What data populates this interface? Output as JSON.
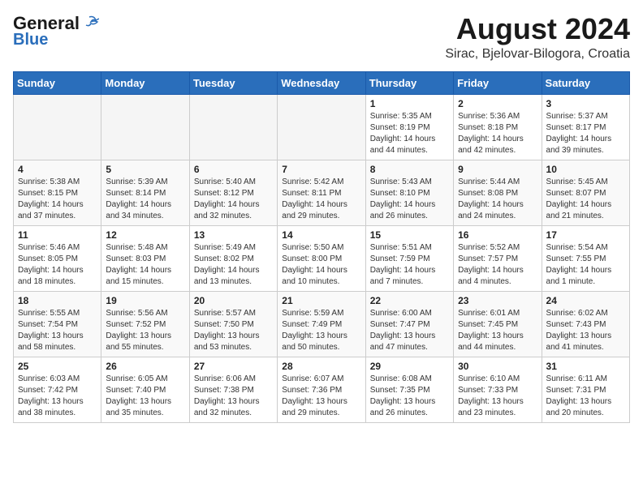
{
  "header": {
    "logo_line1": "General",
    "logo_line2": "Blue",
    "title": "August 2024",
    "subtitle": "Sirac, Bjelovar-Bilogora, Croatia"
  },
  "days_of_week": [
    "Sunday",
    "Monday",
    "Tuesday",
    "Wednesday",
    "Thursday",
    "Friday",
    "Saturday"
  ],
  "weeks": [
    [
      {
        "day": "",
        "info": ""
      },
      {
        "day": "",
        "info": ""
      },
      {
        "day": "",
        "info": ""
      },
      {
        "day": "",
        "info": ""
      },
      {
        "day": "1",
        "info": "Sunrise: 5:35 AM\nSunset: 8:19 PM\nDaylight: 14 hours\nand 44 minutes."
      },
      {
        "day": "2",
        "info": "Sunrise: 5:36 AM\nSunset: 8:18 PM\nDaylight: 14 hours\nand 42 minutes."
      },
      {
        "day": "3",
        "info": "Sunrise: 5:37 AM\nSunset: 8:17 PM\nDaylight: 14 hours\nand 39 minutes."
      }
    ],
    [
      {
        "day": "4",
        "info": "Sunrise: 5:38 AM\nSunset: 8:15 PM\nDaylight: 14 hours\nand 37 minutes."
      },
      {
        "day": "5",
        "info": "Sunrise: 5:39 AM\nSunset: 8:14 PM\nDaylight: 14 hours\nand 34 minutes."
      },
      {
        "day": "6",
        "info": "Sunrise: 5:40 AM\nSunset: 8:12 PM\nDaylight: 14 hours\nand 32 minutes."
      },
      {
        "day": "7",
        "info": "Sunrise: 5:42 AM\nSunset: 8:11 PM\nDaylight: 14 hours\nand 29 minutes."
      },
      {
        "day": "8",
        "info": "Sunrise: 5:43 AM\nSunset: 8:10 PM\nDaylight: 14 hours\nand 26 minutes."
      },
      {
        "day": "9",
        "info": "Sunrise: 5:44 AM\nSunset: 8:08 PM\nDaylight: 14 hours\nand 24 minutes."
      },
      {
        "day": "10",
        "info": "Sunrise: 5:45 AM\nSunset: 8:07 PM\nDaylight: 14 hours\nand 21 minutes."
      }
    ],
    [
      {
        "day": "11",
        "info": "Sunrise: 5:46 AM\nSunset: 8:05 PM\nDaylight: 14 hours\nand 18 minutes."
      },
      {
        "day": "12",
        "info": "Sunrise: 5:48 AM\nSunset: 8:03 PM\nDaylight: 14 hours\nand 15 minutes."
      },
      {
        "day": "13",
        "info": "Sunrise: 5:49 AM\nSunset: 8:02 PM\nDaylight: 14 hours\nand 13 minutes."
      },
      {
        "day": "14",
        "info": "Sunrise: 5:50 AM\nSunset: 8:00 PM\nDaylight: 14 hours\nand 10 minutes."
      },
      {
        "day": "15",
        "info": "Sunrise: 5:51 AM\nSunset: 7:59 PM\nDaylight: 14 hours\nand 7 minutes."
      },
      {
        "day": "16",
        "info": "Sunrise: 5:52 AM\nSunset: 7:57 PM\nDaylight: 14 hours\nand 4 minutes."
      },
      {
        "day": "17",
        "info": "Sunrise: 5:54 AM\nSunset: 7:55 PM\nDaylight: 14 hours\nand 1 minute."
      }
    ],
    [
      {
        "day": "18",
        "info": "Sunrise: 5:55 AM\nSunset: 7:54 PM\nDaylight: 13 hours\nand 58 minutes."
      },
      {
        "day": "19",
        "info": "Sunrise: 5:56 AM\nSunset: 7:52 PM\nDaylight: 13 hours\nand 55 minutes."
      },
      {
        "day": "20",
        "info": "Sunrise: 5:57 AM\nSunset: 7:50 PM\nDaylight: 13 hours\nand 53 minutes."
      },
      {
        "day": "21",
        "info": "Sunrise: 5:59 AM\nSunset: 7:49 PM\nDaylight: 13 hours\nand 50 minutes."
      },
      {
        "day": "22",
        "info": "Sunrise: 6:00 AM\nSunset: 7:47 PM\nDaylight: 13 hours\nand 47 minutes."
      },
      {
        "day": "23",
        "info": "Sunrise: 6:01 AM\nSunset: 7:45 PM\nDaylight: 13 hours\nand 44 minutes."
      },
      {
        "day": "24",
        "info": "Sunrise: 6:02 AM\nSunset: 7:43 PM\nDaylight: 13 hours\nand 41 minutes."
      }
    ],
    [
      {
        "day": "25",
        "info": "Sunrise: 6:03 AM\nSunset: 7:42 PM\nDaylight: 13 hours\nand 38 minutes."
      },
      {
        "day": "26",
        "info": "Sunrise: 6:05 AM\nSunset: 7:40 PM\nDaylight: 13 hours\nand 35 minutes."
      },
      {
        "day": "27",
        "info": "Sunrise: 6:06 AM\nSunset: 7:38 PM\nDaylight: 13 hours\nand 32 minutes."
      },
      {
        "day": "28",
        "info": "Sunrise: 6:07 AM\nSunset: 7:36 PM\nDaylight: 13 hours\nand 29 minutes."
      },
      {
        "day": "29",
        "info": "Sunrise: 6:08 AM\nSunset: 7:35 PM\nDaylight: 13 hours\nand 26 minutes."
      },
      {
        "day": "30",
        "info": "Sunrise: 6:10 AM\nSunset: 7:33 PM\nDaylight: 13 hours\nand 23 minutes."
      },
      {
        "day": "31",
        "info": "Sunrise: 6:11 AM\nSunset: 7:31 PM\nDaylight: 13 hours\nand 20 minutes."
      }
    ]
  ]
}
